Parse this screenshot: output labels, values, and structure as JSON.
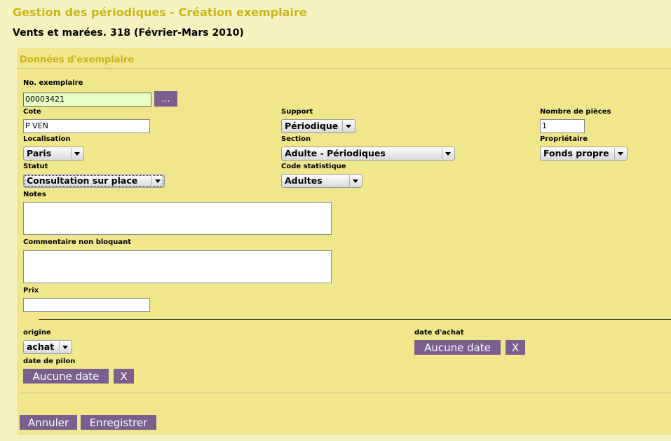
{
  "header": {
    "title": "Gestion des périodiques - Création exemplaire",
    "document": "Vents et marées. 318 (Février-Mars 2010)"
  },
  "panel": {
    "title": "Données d'exemplaire"
  },
  "fields": {
    "no_exemplaire": {
      "label": "No. exemplaire",
      "value": "00003421",
      "lookup_label": "..."
    },
    "cote": {
      "label": "Cote",
      "value": "P VEN"
    },
    "support": {
      "label": "Support",
      "value": "Périodique"
    },
    "nombre_pieces": {
      "label": "Nombre de pièces",
      "value": "1"
    },
    "localisation": {
      "label": "Localisation",
      "value": "Paris"
    },
    "section": {
      "label": "Section",
      "value": "Adulte - Périodiques"
    },
    "proprietaire": {
      "label": "Propriétaire",
      "value": "Fonds propre"
    },
    "statut": {
      "label": "Statut",
      "value": "Consultation sur place"
    },
    "code_statistique": {
      "label": "Code statistique",
      "value": "Adultes"
    },
    "notes": {
      "label": "Notes",
      "value": ""
    },
    "commentaire": {
      "label": "Commentaire non bloquant",
      "value": ""
    },
    "prix": {
      "label": "Prix",
      "value": ""
    },
    "origine": {
      "label": "origine",
      "value": "achat"
    },
    "date_achat": {
      "label": "date d'achat",
      "date_button": "Aucune date",
      "clear_button": "X"
    },
    "date_pilon": {
      "label": "date de pilon",
      "date_button": "Aucune date",
      "clear_button": "X"
    }
  },
  "actions": {
    "cancel": "Annuler",
    "save": "Enregistrer"
  },
  "colors": {
    "background": "#f7f3c1",
    "panel": "#f0e68c",
    "title": "#c9b418",
    "button": "#7a5f8e",
    "highlight_input": "#e8ffc8"
  }
}
